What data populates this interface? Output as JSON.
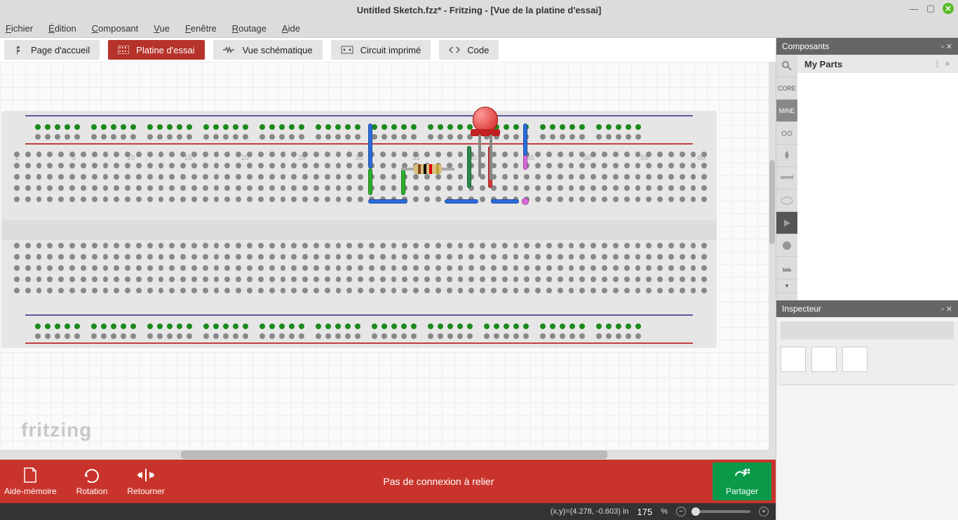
{
  "title": "Untitled Sketch.fzz* - Fritzing - [Vue de la platine d'essai]",
  "menu": {
    "file": "Fichier",
    "edit": "Édition",
    "component": "Composant",
    "view": "Vue",
    "window": "Fenêtre",
    "routing": "Routage",
    "help": "Aide"
  },
  "tabs": {
    "home": "Page d'accueil",
    "breadboard": "Platine d'essai",
    "schematic": "Vue schématique",
    "pcb": "Circuit imprimé",
    "code": "Code"
  },
  "breadboard": {
    "col_labels": [
      "1",
      "5",
      "10",
      "15",
      "20",
      "25",
      "30",
      "35",
      "40",
      "45",
      "50",
      "55",
      "60"
    ]
  },
  "logo": "fritzing",
  "sidepanel": {
    "components": {
      "title": "Composants",
      "my_parts": "My Parts",
      "bins": {
        "search": "SEARCH",
        "core": "CORE",
        "mine": "MINE"
      }
    },
    "inspector": {
      "title": "Inspecteur"
    }
  },
  "bottombar": {
    "aidememoire": "Aide-mémoire",
    "rotation": "Rotation",
    "retourner": "Retourner",
    "message": "Pas de connexion à relier",
    "partager": "Partager"
  },
  "statusbar": {
    "coords": "(x,y)=(4.278, -0.603) in",
    "zoom_value": "175",
    "zoom_unit": "%"
  }
}
